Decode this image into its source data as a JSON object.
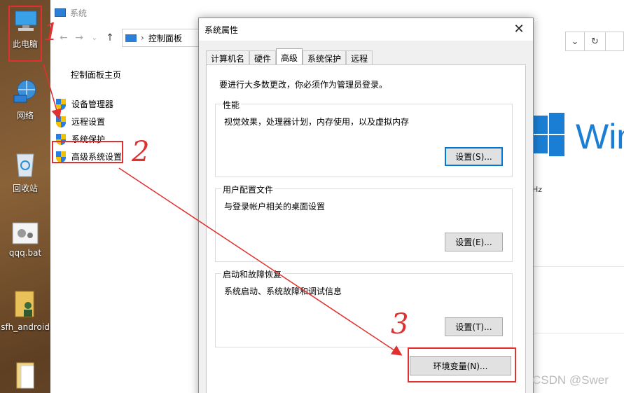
{
  "desktop": {
    "icons": [
      {
        "label": "此电脑"
      },
      {
        "label": "网络"
      },
      {
        "label": "回收站"
      },
      {
        "label": "qqq.bat"
      },
      {
        "label": "sfh_android"
      }
    ]
  },
  "explorer": {
    "title": "系统",
    "address": "控制面板",
    "nav": {
      "back": "←",
      "forward": "→",
      "dropdown": "⌄",
      "up": "↑",
      "address_sep": "›"
    },
    "address_tools": {
      "dropdown": "⌄",
      "refresh": "↻"
    },
    "sidebar": {
      "home": "控制面板主页",
      "links": [
        "设备管理器",
        "远程设置",
        "系统保护",
        "高级系统设置"
      ]
    },
    "brand_text": "Win",
    "hz_text": "Hz"
  },
  "dialog": {
    "title": "系统属性",
    "close": "✕",
    "tabs": [
      "计算机名",
      "硬件",
      "高级",
      "系统保护",
      "远程"
    ],
    "active_tab": "高级",
    "admin_note": "要进行大多数更改，你必须作为管理员登录。",
    "performance": {
      "title": "性能",
      "desc": "视觉效果，处理器计划，内存使用，以及虚拟内存",
      "button": "设置(S)..."
    },
    "user_profiles": {
      "title": "用户配置文件",
      "desc": "与登录帐户相关的桌面设置",
      "button": "设置(E)..."
    },
    "startup_recovery": {
      "title": "启动和故障恢复",
      "desc": "系统启动、系统故障和调试信息",
      "button": "设置(T)..."
    },
    "env_button": "环境变量(N)..."
  },
  "annotations": {
    "step1": "1",
    "step2": "2",
    "step3": "3",
    "color": "#e03030"
  },
  "watermark": "CSDN @Swer"
}
